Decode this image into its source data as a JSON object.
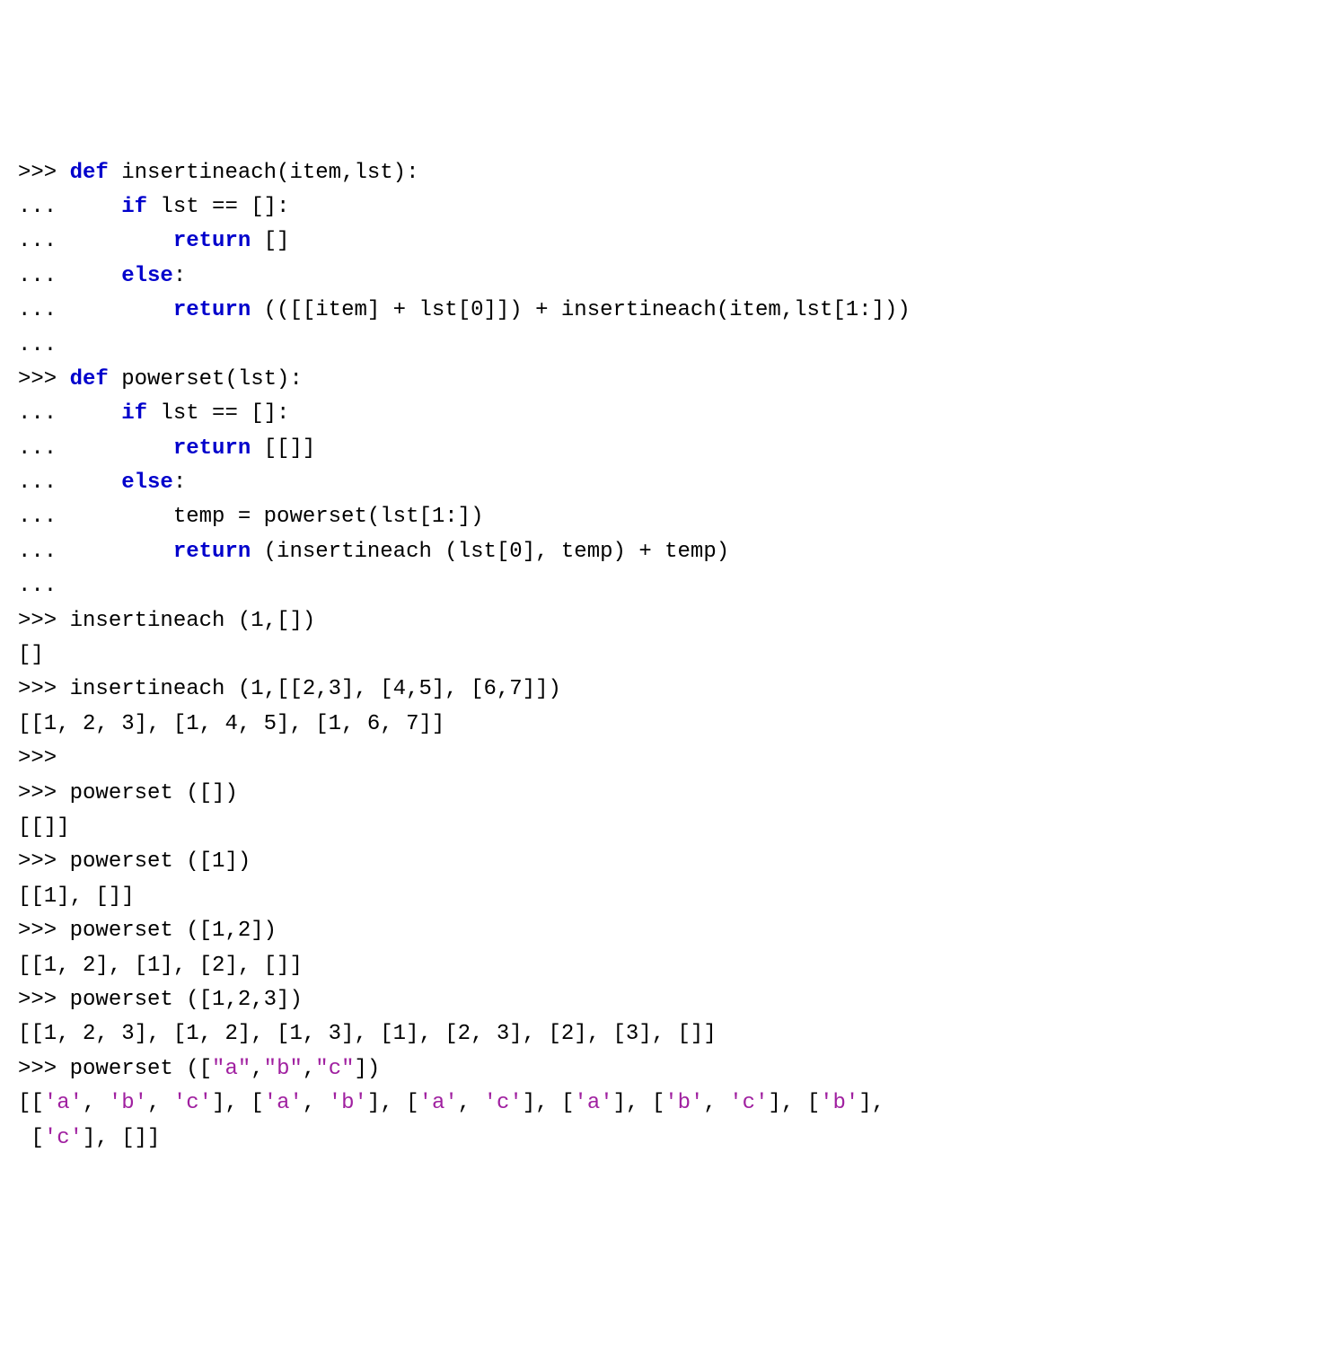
{
  "code": {
    "lines": [
      {
        "segments": [
          {
            "t": ">>> ",
            "c": ""
          },
          {
            "t": "def",
            "c": "kw"
          },
          {
            "t": " insertineach(item,lst):",
            "c": ""
          }
        ]
      },
      {
        "segments": [
          {
            "t": "...     ",
            "c": ""
          },
          {
            "t": "if",
            "c": "kw"
          },
          {
            "t": " lst == []:",
            "c": ""
          }
        ]
      },
      {
        "segments": [
          {
            "t": "...         ",
            "c": ""
          },
          {
            "t": "return",
            "c": "kw"
          },
          {
            "t": " []",
            "c": ""
          }
        ]
      },
      {
        "segments": [
          {
            "t": "...     ",
            "c": ""
          },
          {
            "t": "else",
            "c": "kw"
          },
          {
            "t": ":",
            "c": ""
          }
        ]
      },
      {
        "segments": [
          {
            "t": "...         ",
            "c": ""
          },
          {
            "t": "return",
            "c": "kw"
          },
          {
            "t": " (([[item] + lst[0]]) + insertineach(item,lst[1:]))",
            "c": ""
          }
        ]
      },
      {
        "segments": [
          {
            "t": "...",
            "c": ""
          }
        ]
      },
      {
        "segments": [
          {
            "t": ">>> ",
            "c": ""
          },
          {
            "t": "def",
            "c": "kw"
          },
          {
            "t": " powerset(lst):",
            "c": ""
          }
        ]
      },
      {
        "segments": [
          {
            "t": "...     ",
            "c": ""
          },
          {
            "t": "if",
            "c": "kw"
          },
          {
            "t": " lst == []:",
            "c": ""
          }
        ]
      },
      {
        "segments": [
          {
            "t": "...         ",
            "c": ""
          },
          {
            "t": "return",
            "c": "kw"
          },
          {
            "t": " [[]]",
            "c": ""
          }
        ]
      },
      {
        "segments": [
          {
            "t": "...     ",
            "c": ""
          },
          {
            "t": "else",
            "c": "kw"
          },
          {
            "t": ":",
            "c": ""
          }
        ]
      },
      {
        "segments": [
          {
            "t": "...         temp = powerset(lst[1:])",
            "c": ""
          }
        ]
      },
      {
        "segments": [
          {
            "t": "...         ",
            "c": ""
          },
          {
            "t": "return",
            "c": "kw"
          },
          {
            "t": " (insertineach (lst[0], temp) + temp)",
            "c": ""
          }
        ]
      },
      {
        "segments": [
          {
            "t": "...",
            "c": ""
          }
        ]
      },
      {
        "segments": [
          {
            "t": ">>> insertineach (1,[])",
            "c": ""
          }
        ]
      },
      {
        "segments": [
          {
            "t": "[]",
            "c": ""
          }
        ]
      },
      {
        "segments": [
          {
            "t": ">>> insertineach (1,[[2,3], [4,5], [6,7]])",
            "c": ""
          }
        ]
      },
      {
        "segments": [
          {
            "t": "[[1, 2, 3], [1, 4, 5], [1, 6, 7]]",
            "c": ""
          }
        ]
      },
      {
        "segments": [
          {
            "t": ">>>",
            "c": ""
          }
        ]
      },
      {
        "segments": [
          {
            "t": ">>> powerset ([])",
            "c": ""
          }
        ]
      },
      {
        "segments": [
          {
            "t": "[[]]",
            "c": ""
          }
        ]
      },
      {
        "segments": [
          {
            "t": ">>> powerset ([1])",
            "c": ""
          }
        ]
      },
      {
        "segments": [
          {
            "t": "[[1], []]",
            "c": ""
          }
        ]
      },
      {
        "segments": [
          {
            "t": ">>> powerset ([1,2])",
            "c": ""
          }
        ]
      },
      {
        "segments": [
          {
            "t": "[[1, 2], [1], [2], []]",
            "c": ""
          }
        ]
      },
      {
        "segments": [
          {
            "t": ">>> powerset ([1,2,3])",
            "c": ""
          }
        ]
      },
      {
        "segments": [
          {
            "t": "[[1, 2, 3], [1, 2], [1, 3], [1], [2, 3], [2], [3], []]",
            "c": ""
          }
        ]
      },
      {
        "segments": [
          {
            "t": ">>> powerset ([",
            "c": ""
          },
          {
            "t": "\"a\"",
            "c": "str"
          },
          {
            "t": ",",
            "c": ""
          },
          {
            "t": "\"b\"",
            "c": "str"
          },
          {
            "t": ",",
            "c": ""
          },
          {
            "t": "\"c\"",
            "c": "str"
          },
          {
            "t": "])",
            "c": ""
          }
        ]
      },
      {
        "segments": [
          {
            "t": "[[",
            "c": ""
          },
          {
            "t": "'a'",
            "c": "str"
          },
          {
            "t": ", ",
            "c": ""
          },
          {
            "t": "'b'",
            "c": "str"
          },
          {
            "t": ", ",
            "c": ""
          },
          {
            "t": "'c'",
            "c": "str"
          },
          {
            "t": "], [",
            "c": ""
          },
          {
            "t": "'a'",
            "c": "str"
          },
          {
            "t": ", ",
            "c": ""
          },
          {
            "t": "'b'",
            "c": "str"
          },
          {
            "t": "], [",
            "c": ""
          },
          {
            "t": "'a'",
            "c": "str"
          },
          {
            "t": ", ",
            "c": ""
          },
          {
            "t": "'c'",
            "c": "str"
          },
          {
            "t": "], [",
            "c": ""
          },
          {
            "t": "'a'",
            "c": "str"
          },
          {
            "t": "], [",
            "c": ""
          },
          {
            "t": "'b'",
            "c": "str"
          },
          {
            "t": ", ",
            "c": ""
          },
          {
            "t": "'c'",
            "c": "str"
          },
          {
            "t": "], [",
            "c": ""
          },
          {
            "t": "'b'",
            "c": "str"
          },
          {
            "t": "],",
            "c": ""
          }
        ]
      },
      {
        "segments": [
          {
            "t": " [",
            "c": ""
          },
          {
            "t": "'c'",
            "c": "str"
          },
          {
            "t": "], []]",
            "c": ""
          }
        ]
      }
    ]
  }
}
